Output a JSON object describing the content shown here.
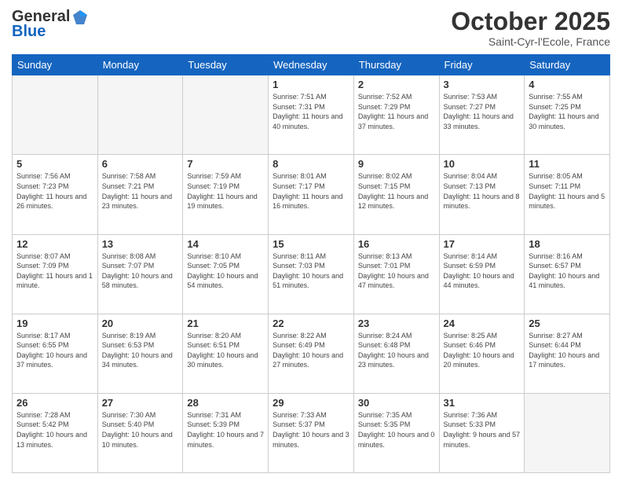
{
  "header": {
    "logo_general": "General",
    "logo_blue": "Blue",
    "month_title": "October 2025",
    "location": "Saint-Cyr-l'Ecole, France"
  },
  "weekdays": [
    "Sunday",
    "Monday",
    "Tuesday",
    "Wednesday",
    "Thursday",
    "Friday",
    "Saturday"
  ],
  "weeks": [
    [
      {
        "day": "",
        "empty": true
      },
      {
        "day": "",
        "empty": true
      },
      {
        "day": "",
        "empty": true
      },
      {
        "day": "1",
        "sunrise": "Sunrise: 7:51 AM",
        "sunset": "Sunset: 7:31 PM",
        "daylight": "Daylight: 11 hours and 40 minutes."
      },
      {
        "day": "2",
        "sunrise": "Sunrise: 7:52 AM",
        "sunset": "Sunset: 7:29 PM",
        "daylight": "Daylight: 11 hours and 37 minutes."
      },
      {
        "day": "3",
        "sunrise": "Sunrise: 7:53 AM",
        "sunset": "Sunset: 7:27 PM",
        "daylight": "Daylight: 11 hours and 33 minutes."
      },
      {
        "day": "4",
        "sunrise": "Sunrise: 7:55 AM",
        "sunset": "Sunset: 7:25 PM",
        "daylight": "Daylight: 11 hours and 30 minutes."
      }
    ],
    [
      {
        "day": "5",
        "sunrise": "Sunrise: 7:56 AM",
        "sunset": "Sunset: 7:23 PM",
        "daylight": "Daylight: 11 hours and 26 minutes."
      },
      {
        "day": "6",
        "sunrise": "Sunrise: 7:58 AM",
        "sunset": "Sunset: 7:21 PM",
        "daylight": "Daylight: 11 hours and 23 minutes."
      },
      {
        "day": "7",
        "sunrise": "Sunrise: 7:59 AM",
        "sunset": "Sunset: 7:19 PM",
        "daylight": "Daylight: 11 hours and 19 minutes."
      },
      {
        "day": "8",
        "sunrise": "Sunrise: 8:01 AM",
        "sunset": "Sunset: 7:17 PM",
        "daylight": "Daylight: 11 hours and 16 minutes."
      },
      {
        "day": "9",
        "sunrise": "Sunrise: 8:02 AM",
        "sunset": "Sunset: 7:15 PM",
        "daylight": "Daylight: 11 hours and 12 minutes."
      },
      {
        "day": "10",
        "sunrise": "Sunrise: 8:04 AM",
        "sunset": "Sunset: 7:13 PM",
        "daylight": "Daylight: 11 hours and 8 minutes."
      },
      {
        "day": "11",
        "sunrise": "Sunrise: 8:05 AM",
        "sunset": "Sunset: 7:11 PM",
        "daylight": "Daylight: 11 hours and 5 minutes."
      }
    ],
    [
      {
        "day": "12",
        "sunrise": "Sunrise: 8:07 AM",
        "sunset": "Sunset: 7:09 PM",
        "daylight": "Daylight: 11 hours and 1 minute."
      },
      {
        "day": "13",
        "sunrise": "Sunrise: 8:08 AM",
        "sunset": "Sunset: 7:07 PM",
        "daylight": "Daylight: 10 hours and 58 minutes."
      },
      {
        "day": "14",
        "sunrise": "Sunrise: 8:10 AM",
        "sunset": "Sunset: 7:05 PM",
        "daylight": "Daylight: 10 hours and 54 minutes."
      },
      {
        "day": "15",
        "sunrise": "Sunrise: 8:11 AM",
        "sunset": "Sunset: 7:03 PM",
        "daylight": "Daylight: 10 hours and 51 minutes."
      },
      {
        "day": "16",
        "sunrise": "Sunrise: 8:13 AM",
        "sunset": "Sunset: 7:01 PM",
        "daylight": "Daylight: 10 hours and 47 minutes."
      },
      {
        "day": "17",
        "sunrise": "Sunrise: 8:14 AM",
        "sunset": "Sunset: 6:59 PM",
        "daylight": "Daylight: 10 hours and 44 minutes."
      },
      {
        "day": "18",
        "sunrise": "Sunrise: 8:16 AM",
        "sunset": "Sunset: 6:57 PM",
        "daylight": "Daylight: 10 hours and 41 minutes."
      }
    ],
    [
      {
        "day": "19",
        "sunrise": "Sunrise: 8:17 AM",
        "sunset": "Sunset: 6:55 PM",
        "daylight": "Daylight: 10 hours and 37 minutes."
      },
      {
        "day": "20",
        "sunrise": "Sunrise: 8:19 AM",
        "sunset": "Sunset: 6:53 PM",
        "daylight": "Daylight: 10 hours and 34 minutes."
      },
      {
        "day": "21",
        "sunrise": "Sunrise: 8:20 AM",
        "sunset": "Sunset: 6:51 PM",
        "daylight": "Daylight: 10 hours and 30 minutes."
      },
      {
        "day": "22",
        "sunrise": "Sunrise: 8:22 AM",
        "sunset": "Sunset: 6:49 PM",
        "daylight": "Daylight: 10 hours and 27 minutes."
      },
      {
        "day": "23",
        "sunrise": "Sunrise: 8:24 AM",
        "sunset": "Sunset: 6:48 PM",
        "daylight": "Daylight: 10 hours and 23 minutes."
      },
      {
        "day": "24",
        "sunrise": "Sunrise: 8:25 AM",
        "sunset": "Sunset: 6:46 PM",
        "daylight": "Daylight: 10 hours and 20 minutes."
      },
      {
        "day": "25",
        "sunrise": "Sunrise: 8:27 AM",
        "sunset": "Sunset: 6:44 PM",
        "daylight": "Daylight: 10 hours and 17 minutes."
      }
    ],
    [
      {
        "day": "26",
        "sunrise": "Sunrise: 7:28 AM",
        "sunset": "Sunset: 5:42 PM",
        "daylight": "Daylight: 10 hours and 13 minutes."
      },
      {
        "day": "27",
        "sunrise": "Sunrise: 7:30 AM",
        "sunset": "Sunset: 5:40 PM",
        "daylight": "Daylight: 10 hours and 10 minutes."
      },
      {
        "day": "28",
        "sunrise": "Sunrise: 7:31 AM",
        "sunset": "Sunset: 5:39 PM",
        "daylight": "Daylight: 10 hours and 7 minutes."
      },
      {
        "day": "29",
        "sunrise": "Sunrise: 7:33 AM",
        "sunset": "Sunset: 5:37 PM",
        "daylight": "Daylight: 10 hours and 3 minutes."
      },
      {
        "day": "30",
        "sunrise": "Sunrise: 7:35 AM",
        "sunset": "Sunset: 5:35 PM",
        "daylight": "Daylight: 10 hours and 0 minutes."
      },
      {
        "day": "31",
        "sunrise": "Sunrise: 7:36 AM",
        "sunset": "Sunset: 5:33 PM",
        "daylight": "Daylight: 9 hours and 57 minutes."
      },
      {
        "day": "",
        "empty": true
      }
    ]
  ]
}
